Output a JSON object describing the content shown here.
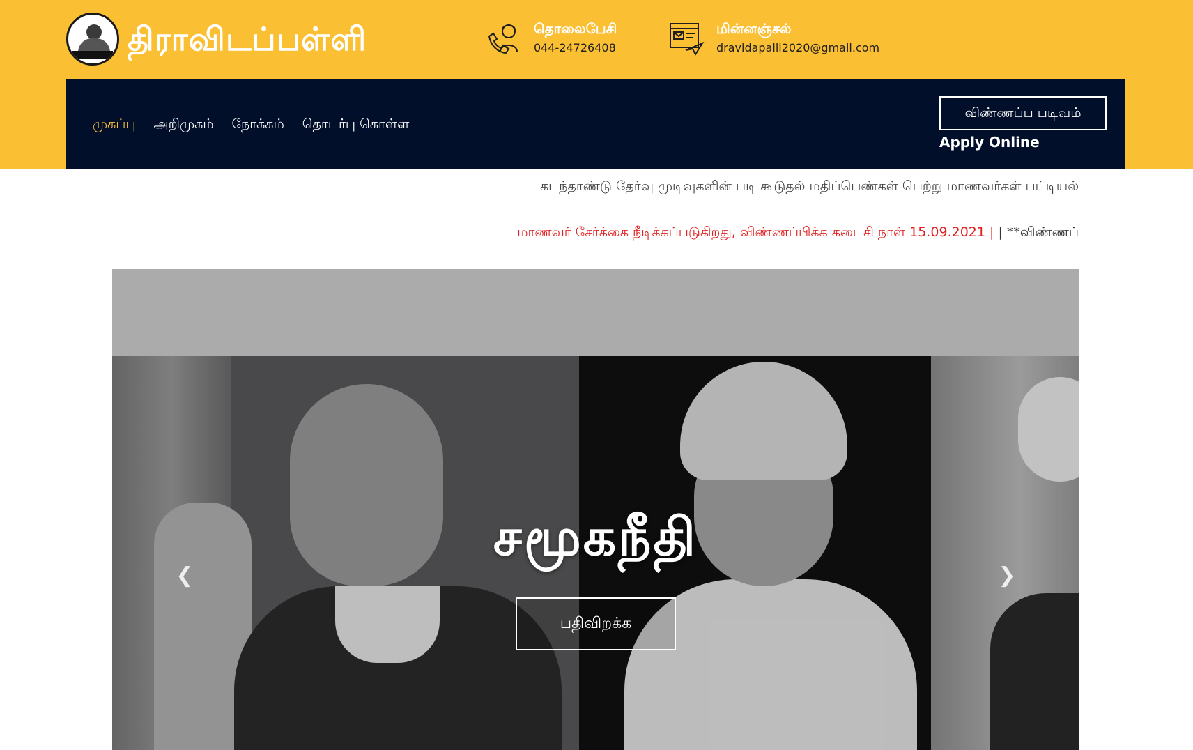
{
  "header": {
    "site_title": "திராவிடப்பள்ளி",
    "logo_text": "திராவிடப்பள்ளி",
    "phone": {
      "title": "தொலைபேசி",
      "value": "044-24726408",
      "icon": "phone-support-icon"
    },
    "email": {
      "title": "மின்னஞ்சல்",
      "value": "dravidapalli2020@gmail.com",
      "icon": "email-send-icon"
    }
  },
  "nav": {
    "items": [
      {
        "label": "முகப்பு",
        "active": true
      },
      {
        "label": "அறிமுகம்",
        "active": false
      },
      {
        "label": "நோக்கம்",
        "active": false
      },
      {
        "label": "தொடர்பு கொள்ள",
        "active": false
      }
    ],
    "apply_button": "விண்ணப்ப படிவம்",
    "apply_online": "Apply Online"
  },
  "ticker": {
    "line1": "கடந்தாண்டு தேர்வு முடிவுகளின் படி கூடுதல் மதிப்பெண்கள் பெற்று மாணவர்கள் பட்டியல்",
    "line2_red": "மாணவர் சேர்க்கை நீடிக்கப்படுகிறது, விண்ணப்பிக்க கடைசி நாள் 15.09.2021 |",
    "line2_dark": " | **விண்ணப்"
  },
  "slider": {
    "caption": "சமூகநீதி",
    "button": "பதிவிறக்க",
    "prev_icon": "chevron-left-icon",
    "next_icon": "chevron-right-icon"
  },
  "colors": {
    "brand_yellow": "#fbbf34",
    "navbar_dark": "#020f2b",
    "ticker_red": "#e02020"
  }
}
